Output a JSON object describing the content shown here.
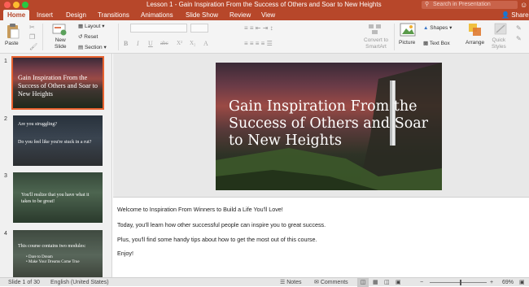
{
  "window": {
    "title": "Lesson 1 - Gain Inspiration From the Success of Others and Soar to New Heights",
    "search_placeholder": "Search in Presentation"
  },
  "tabs": [
    "Home",
    "Insert",
    "Design",
    "Transitions",
    "Animations",
    "Slide Show",
    "Review",
    "View"
  ],
  "share_label": "Share",
  "ribbon": {
    "paste": "Paste",
    "new_slide": "New\nSlide",
    "layout": "Layout",
    "reset": "Reset",
    "section": "Section",
    "convert": "Convert to\nSmartArt",
    "picture": "Picture",
    "shapes": "Shapes",
    "text_box": "Text Box",
    "arrange": "Arrange",
    "quick_styles": "Quick\nStyles",
    "format_buttons": [
      "B",
      "I",
      "U",
      "abc",
      "X²",
      "X₂",
      "A"
    ]
  },
  "slides": [
    {
      "num": "1",
      "text": "Gain Inspiration From the Success of Others and Soar to New Heights"
    },
    {
      "num": "2",
      "text_a": "Are you struggling?",
      "text_b": "Do you feel like you're stuck in a rut?"
    },
    {
      "num": "3",
      "text": "You'll realize that you have what it takes to be great!"
    },
    {
      "num": "4",
      "text": "This course contains two modules:",
      "bullets": [
        "Dare to Dream",
        "Make Your Dreams Come True"
      ]
    }
  ],
  "main_slide": {
    "title": "Gain Inspiration From the Success of Others and Soar to New Heights"
  },
  "notes": [
    "Welcome to Inspiration From Winners to Build a Life You'll Love!",
    "Today, you'll learn how other successful people can inspire you to great success.",
    "Plus, you'll find some handy tips about how to get the most out of this course.",
    "Enjoy!"
  ],
  "status": {
    "slide_count": "Slide 1 of 30",
    "language": "English (United States)",
    "notes": "Notes",
    "comments": "Comments",
    "zoom": "69%"
  },
  "colors": {
    "accent": "#b7472a",
    "selection": "#e8622f"
  }
}
